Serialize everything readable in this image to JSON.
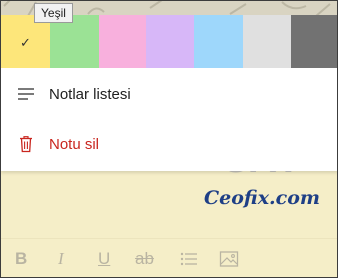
{
  "tooltip": {
    "text": "Yeşil"
  },
  "palette": {
    "selected_index": 0,
    "swatches": [
      {
        "name": "yellow",
        "color": "#fde67a",
        "width": 49
      },
      {
        "name": "green",
        "color": "#9be295",
        "width": 49
      },
      {
        "name": "pink",
        "color": "#f8b0dd",
        "width": 47
      },
      {
        "name": "purple",
        "color": "#d7b7f8",
        "width": 48
      },
      {
        "name": "blue",
        "color": "#9ed7fb",
        "width": 49
      },
      {
        "name": "gray",
        "color": "#e0e0e0",
        "width": 48
      },
      {
        "name": "charcoal",
        "color": "#727272",
        "width": 47
      }
    ],
    "check_glyph": "✓"
  },
  "menu": {
    "list_label": "Notlar listesi",
    "delete_label": "Notu sil",
    "delete_color": "#c9261f"
  },
  "watermark": {
    "logo": "GFX",
    "site": "Ceofix.com"
  },
  "toolbar": {
    "bold": "B",
    "italic": "I",
    "underline": "U",
    "strikethrough": "ab",
    "icons": [
      "bold-icon",
      "italic-icon",
      "underline-icon",
      "strikethrough-icon",
      "bullet-list-icon",
      "image-icon"
    ]
  }
}
